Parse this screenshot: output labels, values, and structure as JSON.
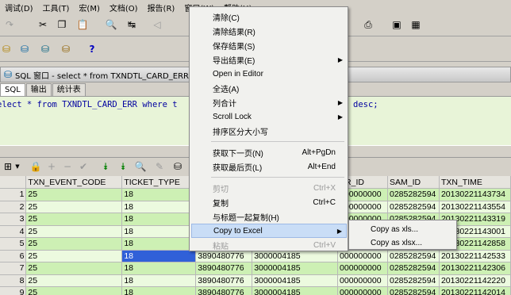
{
  "menubar": [
    "调试(D)",
    "工具(T)",
    "宏(M)",
    "文档(O)",
    "报告(R)",
    "窗口(W)",
    "帮助(H)"
  ],
  "window_title": "SQL 窗口 - select * from TXNDTL_CARD_ERR whe",
  "tabs": [
    "SQL",
    "输出",
    "统计表"
  ],
  "editor": {
    "line1": "elect * from TXNDTL_CARD_ERR where t",
    "line2": "desc;"
  },
  "toolbar": {
    "help": "?"
  },
  "grid": {
    "columns": [
      "",
      "TXN_EVENT_CODE",
      "TICKET_TYPE",
      "",
      "",
      "PR_ID",
      "SAM_ID",
      "TXN_TIME"
    ],
    "rows": [
      {
        "n": "1",
        "c": [
          "25",
          "18",
          "",
          "",
          "000000000",
          "0285282594",
          "20130221143734"
        ],
        "s": "g"
      },
      {
        "n": "2",
        "c": [
          "25",
          "18",
          "",
          "",
          "000000000",
          "0285282594",
          "20130221143554"
        ],
        "s": "w"
      },
      {
        "n": "3",
        "c": [
          "25",
          "18",
          "",
          "",
          "000000000",
          "0285282594",
          "20130221143319"
        ],
        "s": "g"
      },
      {
        "n": "4",
        "c": [
          "25",
          "18",
          "",
          "",
          "000000000",
          "0285282594",
          "20130221143001"
        ],
        "s": "w"
      },
      {
        "n": "5",
        "c": [
          "25",
          "18",
          "",
          "",
          "000000000",
          "0285282594",
          "20130221142858"
        ],
        "s": "g"
      },
      {
        "n": "6",
        "c": [
          "25",
          "18",
          "3890480776",
          "3000004185",
          "000000000",
          "0285282594",
          "20130221142533"
        ],
        "s": "w"
      },
      {
        "n": "7",
        "c": [
          "25",
          "18",
          "3890480776",
          "3000004185",
          "000000000",
          "0285282594",
          "20130221142306"
        ],
        "s": "g"
      },
      {
        "n": "8",
        "c": [
          "25",
          "18",
          "3890480776",
          "3000004185",
          "000000000",
          "0285282594",
          "20130221142220"
        ],
        "s": "w"
      },
      {
        "n": "9",
        "c": [
          "25",
          "18",
          "3890480776",
          "3000004185",
          "000000000",
          "0285282594",
          "20130221142014"
        ],
        "s": "g"
      }
    ]
  },
  "context_menu": [
    {
      "label": "清除(C)",
      "sc": "",
      "arrow": false,
      "dis": false,
      "hl": false
    },
    {
      "label": "清除结果(R)",
      "sc": "",
      "arrow": false,
      "dis": false,
      "hl": false
    },
    {
      "label": "保存结果(S)",
      "sc": "",
      "arrow": false,
      "dis": false,
      "hl": false
    },
    {
      "label": "导出结果(E)",
      "sc": "",
      "arrow": true,
      "dis": false,
      "hl": false
    },
    {
      "label": "Open in Editor",
      "sc": "",
      "arrow": false,
      "dis": false,
      "hl": false
    },
    {
      "label": "全选(A)",
      "sc": "",
      "arrow": false,
      "dis": false,
      "hl": false
    },
    {
      "label": "列合计",
      "sc": "",
      "arrow": true,
      "dis": false,
      "hl": false
    },
    {
      "label": "Scroll Lock",
      "sc": "",
      "arrow": true,
      "dis": false,
      "hl": false
    },
    {
      "label": "排序区分大小写",
      "sc": "",
      "arrow": false,
      "dis": false,
      "hl": false
    },
    {
      "sep": true
    },
    {
      "label": "获取下一页(N)",
      "sc": "Alt+PgDn",
      "arrow": false,
      "dis": false,
      "hl": false
    },
    {
      "label": "获取最后页(L)",
      "sc": "Alt+End",
      "arrow": false,
      "dis": false,
      "hl": false
    },
    {
      "sep": true
    },
    {
      "label": "剪切",
      "sc": "Ctrl+X",
      "arrow": false,
      "dis": true,
      "hl": false
    },
    {
      "label": "复制",
      "sc": "Ctrl+C",
      "arrow": false,
      "dis": false,
      "hl": false
    },
    {
      "label": "与标题一起复制(H)",
      "sc": "",
      "arrow": false,
      "dis": false,
      "hl": false
    },
    {
      "label": "Copy to Excel",
      "sc": "",
      "arrow": true,
      "dis": false,
      "hl": true
    },
    {
      "label": "粘贴",
      "sc": "Ctrl+V",
      "arrow": false,
      "dis": true,
      "hl": false
    }
  ],
  "submenu": [
    "Copy as xls...",
    "Copy as xlsx..."
  ]
}
